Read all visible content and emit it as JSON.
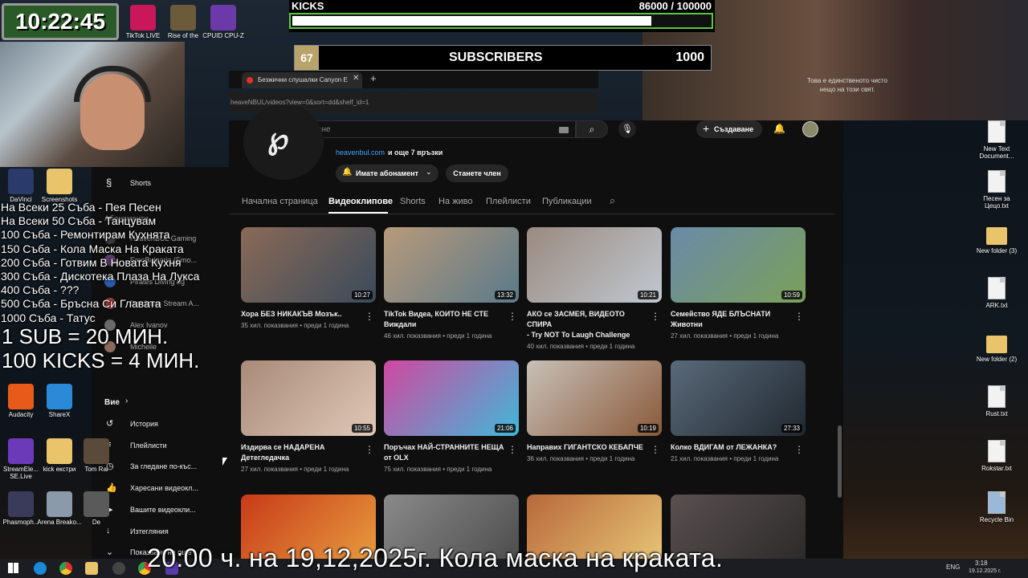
{
  "clock": "10:22:45",
  "top_icons": [
    {
      "label": "TikTok LIVE",
      "color": "#c9175a"
    },
    {
      "label": "Rise of the",
      "color": "#6b5b3a"
    },
    {
      "label": "CPUID CPU-Z",
      "color": "#6b3aa8"
    }
  ],
  "kicks": {
    "label": "KICKS",
    "count": "86000 / 100000",
    "progress": 0.86
  },
  "subs": {
    "badge": "67",
    "label": "SUBSCRIBERS",
    "target": "1000"
  },
  "video_caption": [
    "Това е единственото чисто",
    "нещо  на този свят."
  ],
  "browser": {
    "tab_title": "Безжични слушалки Canyon E",
    "url": "heaveNBUL/videos?view=0&sort=dd&shelf_id=1",
    "search_placeholder": "Търсене",
    "create_label": "Създаване"
  },
  "channel": {
    "link": "heavenbul.com",
    "link_more": "и още 7 връзки",
    "subscribed_label": "Имате абонамент",
    "join_label": "Станете член"
  },
  "tabs": [
    "Начална страница",
    "Видеоклипове",
    "Shorts",
    "На живо",
    "Плейлисти",
    "Публикации"
  ],
  "videos": [
    {
      "title1": "Хора БЕЗ НИКАКЪВ Мозък..",
      "title2": "",
      "meta": "35 хил. показвания • преди 1 година",
      "dur": "10:27",
      "c1": "#8a6a58",
      "c2": "#3a4a5a"
    },
    {
      "title1": "TikTok Видеа, КОИТО НЕ СТЕ",
      "title2": "Виждали",
      "meta": "46 хил. показвания • преди 1 година",
      "dur": "13:32",
      "c1": "#b89a7a",
      "c2": "#5a7a8a"
    },
    {
      "title1": "АКО се ЗАСМЕЯ, ВИДЕОТО СПИРА",
      "title2": "- Try NOT To Laugh Challenge",
      "meta": "40 хил. показвания • преди 1 година",
      "dur": "10:21",
      "c1": "#9a8a80",
      "c2": "#c0c8d0"
    },
    {
      "title1": "Семейство ЯДЕ БЛЪСНАТИ",
      "title2": "Животни",
      "meta": "27 хил. показвания • преди 1 година",
      "dur": "10:59",
      "c1": "#6a8aa8",
      "c2": "#7aa05a"
    },
    {
      "title1": "Издирва се НАДАРЕНА",
      "title2": "Детегледачка",
      "meta": "27 хил. показвания • преди 1 година",
      "dur": "10:55",
      "c1": "#a88a78",
      "c2": "#e0c8b8"
    },
    {
      "title1": "Поръчах НАЙ-СТРАННИТЕ НЕЩА",
      "title2": "от OLX",
      "meta": "75 хил. показвания • преди 1 година",
      "dur": "21:06",
      "c1": "#d048a0",
      "c2": "#40b8d8"
    },
    {
      "title1": "Направих ГИГАНТСКО КЕБАПЧЕ",
      "title2": "",
      "meta": "36 хил. показвания • преди 1 година",
      "dur": "10:19",
      "c1": "#c8c0b8",
      "c2": "#8a5a3a"
    },
    {
      "title1": "Колко ВДИГАМ от ЛЕЖАНКА?",
      "title2": "",
      "meta": "21 хил. показвания • преди 1 година",
      "dur": "27:33",
      "c1": "#5a6a7a",
      "c2": "#202830"
    },
    {
      "title1": "",
      "title2": "",
      "meta": "",
      "dur": "",
      "c1": "#c83a18",
      "c2": "#e8a040"
    },
    {
      "title1": "",
      "title2": "",
      "meta": "",
      "dur": "",
      "c1": "#8a8a8a",
      "c2": "#4a4a4a"
    },
    {
      "title1": "",
      "title2": "",
      "meta": "",
      "dur": "",
      "c1": "#b8683a",
      "c2": "#e8c878"
    },
    {
      "title1": "",
      "title2": "",
      "meta": "",
      "dur": "",
      "c1": "#5a5050",
      "c2": "#2a2828"
    }
  ],
  "sidebar": {
    "shorts": "Shorts",
    "subs_heading": "Абонаменти",
    "channels": [
      "HeavenBUL Gaming",
      "EmoBulgaria (Emo...",
      "Pirates Diving bg",
      "DonStass Stream A...",
      "Alex Ivanov",
      "Michelle"
    ],
    "you_heading": "Вие",
    "you_items": [
      "История",
      "Плейлисти",
      "За гледане по-къс...",
      "Харесани видеокл...",
      "Вашите видеокли...",
      "Изтегляния",
      "Показване на още"
    ]
  },
  "overlay_rules": [
    "На Всеки 25 Съба - Пея Песен",
    "На Всеки 50 Съба - Танцувам",
    "100 Съба - Ремонтирам Кухнята",
    "150 Съба - Кола Маска На Краката",
    "200 Съба - Готвим В Новата Кухня",
    "300 Съба - Дискотека Плаза На Лукса",
    "400 Съба - ???",
    "500 Съба - Бръсна Си Главата",
    "1000 Съба - Татус"
  ],
  "sub_rate": "1 SUB = 20 МИН.",
  "kick_rate": "100 KICKS = 4 МИН.",
  "ticker": "20:00 ч. на 19,12,2025г. Кола маска на краката.",
  "left_icons": [
    {
      "label": "DaVinci",
      "color": "#2a3a6a"
    },
    {
      "label": "Screenshots",
      "color": "#e9c46a"
    },
    {
      "label": "Audacity",
      "color": "#e85a1a"
    },
    {
      "label": "ShareX",
      "color": "#2a8ad8"
    },
    {
      "label": "StreamEle... SE.Live",
      "color": "#6a3ab8"
    },
    {
      "label": "kick екстри",
      "color": "#e9c46a"
    },
    {
      "label": "Tom Rai",
      "color": "#5a4a3a"
    },
    {
      "label": "Phasmoph...",
      "color": "#3a3a5a"
    },
    {
      "label": "Arena Breako...",
      "color": "#8a9aaa"
    },
    {
      "label": "De",
      "color": "#5a5a5a"
    }
  ],
  "right_icons": [
    "New Text Document...",
    "Песен за Цецо.txt",
    "New folder (3)",
    "ARK.txt",
    "New folder (2)",
    "Rust.txt",
    "Rokstar.txt",
    "Recycle Bin"
  ],
  "tray": {
    "lang": "ENG",
    "time": "3:18",
    "date": "19.12.2025 г."
  }
}
